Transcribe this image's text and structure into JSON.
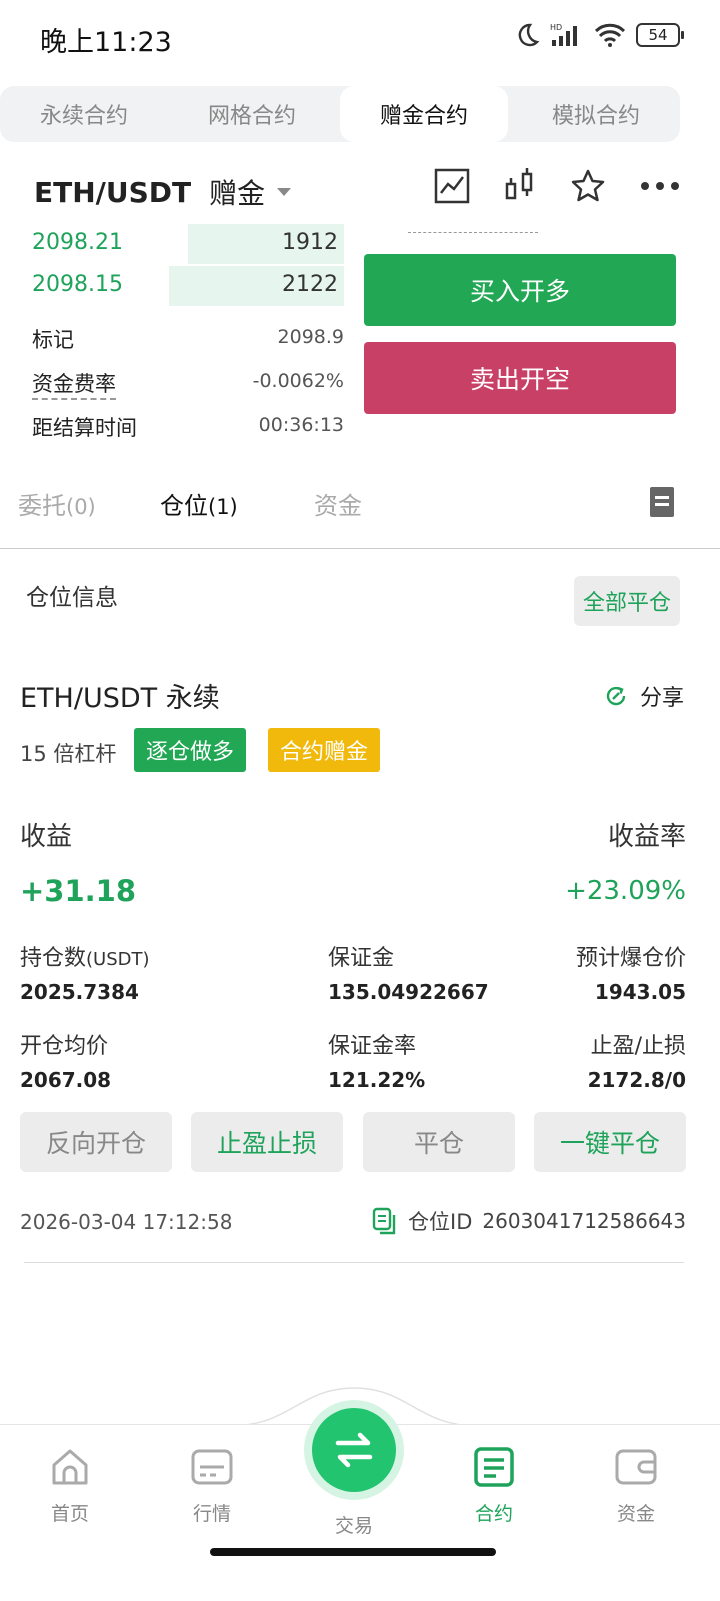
{
  "status": {
    "time": "晚上11:23",
    "battery": "54"
  },
  "tabs": [
    {
      "label": "永续合约"
    },
    {
      "label": "网格合约"
    },
    {
      "label": "赠金合约"
    },
    {
      "label": "模拟合约"
    }
  ],
  "header": {
    "symbol": "ETH/USDT",
    "badge": "赠金"
  },
  "orderbook": {
    "rows": [
      {
        "price": "2098.21",
        "qty": "1912",
        "depth_fraction": 0.5
      },
      {
        "price": "2098.15",
        "qty": "2122",
        "depth_fraction": 0.56
      }
    ]
  },
  "info": {
    "mark_label": "标记",
    "mark_value": "2098.9",
    "funding_label": "资金费率",
    "funding_value": "-0.0062%",
    "settle_label": "距结算时间",
    "settle_value": "00:36:13"
  },
  "actions": {
    "buy": "买入开多",
    "sell": "卖出开空"
  },
  "subtabs": {
    "orders": "委托",
    "orders_count": "(0)",
    "positions": "仓位",
    "positions_count": "(1)",
    "funds": "资金"
  },
  "position": {
    "section_title": "仓位信息",
    "close_all": "全部平仓",
    "symbol": "ETH/USDT 永续",
    "share": "分享",
    "leverage": "15 倍杠杆",
    "tag_side": "逐仓做多",
    "tag_type": "合约赠金",
    "pnl_label": "收益",
    "pnl_value": "+31.18",
    "roe_label": "收益率",
    "roe_value": "+23.09%",
    "size_label": "持仓数",
    "size_unit": "(USDT)",
    "size_value": "2025.7384",
    "margin_label": "保证金",
    "margin_value": "135.04922667",
    "liq_label": "预计爆仓价",
    "liq_value": "1943.05",
    "entry_label": "开仓均价",
    "entry_value": "2067.08",
    "margin_rate_label": "保证金率",
    "margin_rate_value": "121.22%",
    "tpsl_label": "止盈/止损",
    "tpsl_value": "2172.8/0",
    "btn_reverse": "反向开仓",
    "btn_tpsl": "止盈止损",
    "btn_close": "平仓",
    "btn_close_all": "一键平仓",
    "time": "2026-03-04 17:12:58",
    "pos_id_label": "仓位ID",
    "pos_id": "2603041712586643"
  },
  "nav": [
    {
      "label": "首页"
    },
    {
      "label": "行情"
    },
    {
      "label": "交易"
    },
    {
      "label": "合约"
    },
    {
      "label": "资金"
    }
  ],
  "colors": {
    "green": "#1fa35a",
    "red": "#c94066",
    "yellow": "#f0b90b"
  }
}
